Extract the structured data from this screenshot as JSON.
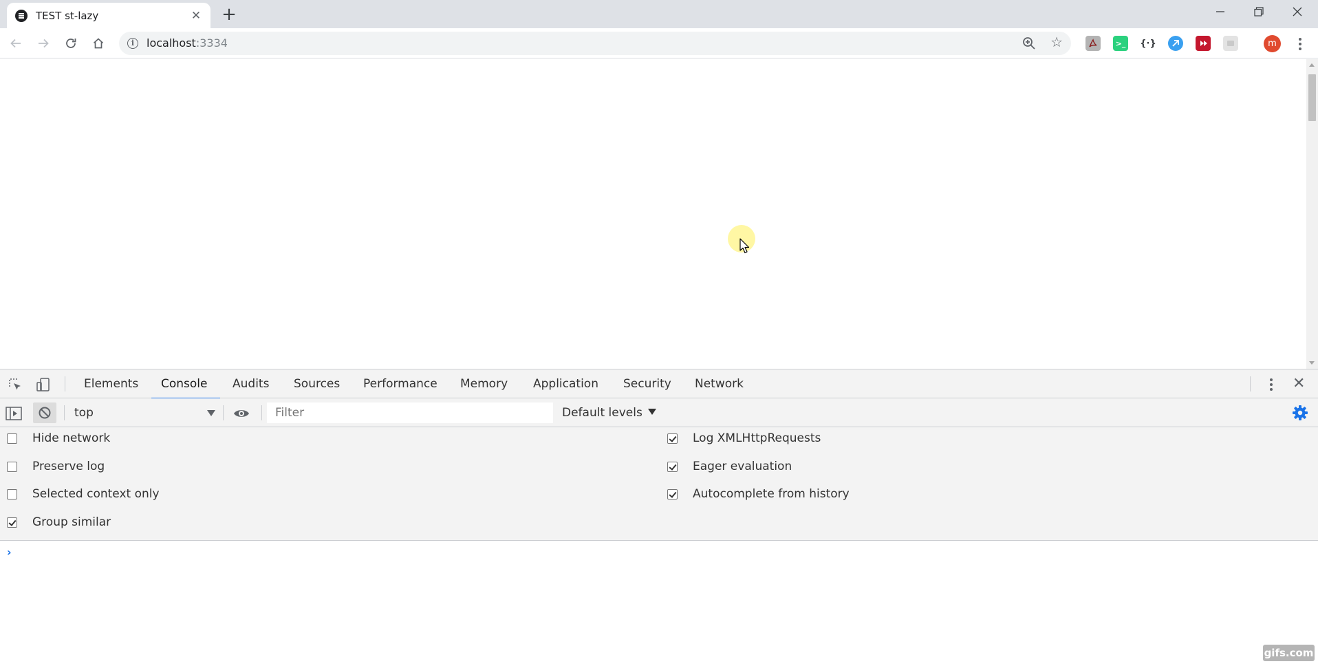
{
  "browser": {
    "tab": {
      "title": "TEST st-lazy"
    },
    "address": {
      "host": "localhost",
      "port": ":3334"
    },
    "avatar_letter": "m",
    "accent": "#1a73e8"
  },
  "devtools": {
    "tabs": [
      "Elements",
      "Console",
      "Audits",
      "Sources",
      "Performance",
      "Memory",
      "Application",
      "Security",
      "Network"
    ],
    "active_tab": "Console",
    "toolbar": {
      "context": "top",
      "filter_placeholder": "Filter",
      "levels": "Default levels"
    },
    "settings": {
      "left": [
        {
          "label": "Hide network",
          "checked": false
        },
        {
          "label": "Preserve log",
          "checked": false
        },
        {
          "label": "Selected context only",
          "checked": false
        },
        {
          "label": "Group similar",
          "checked": true
        }
      ],
      "right": [
        {
          "label": "Log XMLHttpRequests",
          "checked": true
        },
        {
          "label": "Eager evaluation",
          "checked": true
        },
        {
          "label": "Autocomplete from history",
          "checked": true
        }
      ]
    },
    "prompt_symbol": "›"
  },
  "watermark": "gifs.com"
}
